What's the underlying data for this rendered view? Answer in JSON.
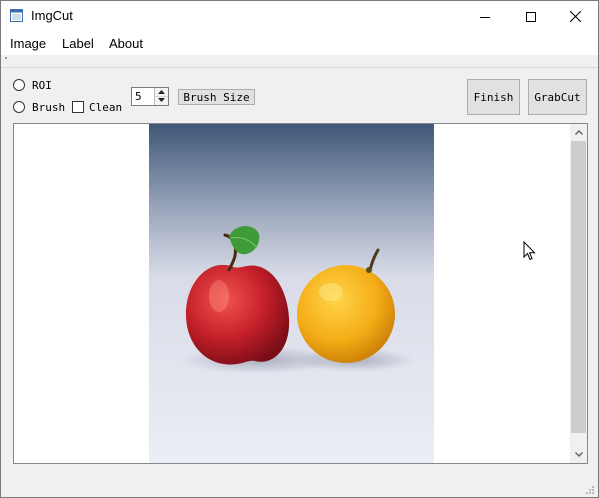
{
  "window": {
    "title": "ImgCut",
    "app_icon": "window-app-icon",
    "controls": [
      "minimize-icon",
      "maximize-icon",
      "close-icon"
    ]
  },
  "menu": {
    "items": [
      "Image",
      "Label",
      "About"
    ]
  },
  "toolbar": {
    "roi_label": "ROI",
    "brush_label": "Brush",
    "clean_label": "Clean",
    "roi_selected": false,
    "brush_selected": false,
    "clean_checked": false,
    "brush_size_value": "5",
    "brush_size_button": "Brush Size",
    "finish_button": "Finish",
    "grabcut_button": "GrabCut"
  },
  "canvas": {
    "image_subject": "red apple and yellow orange photograph",
    "scrollbar": "vertical"
  },
  "colors": {
    "window_bg": "#f0f0f0",
    "titlebar_bg": "#ffffff",
    "button_bg": "#e1e1e1",
    "apple_red": "#c8202a",
    "orange_yellow": "#f4b21a"
  }
}
